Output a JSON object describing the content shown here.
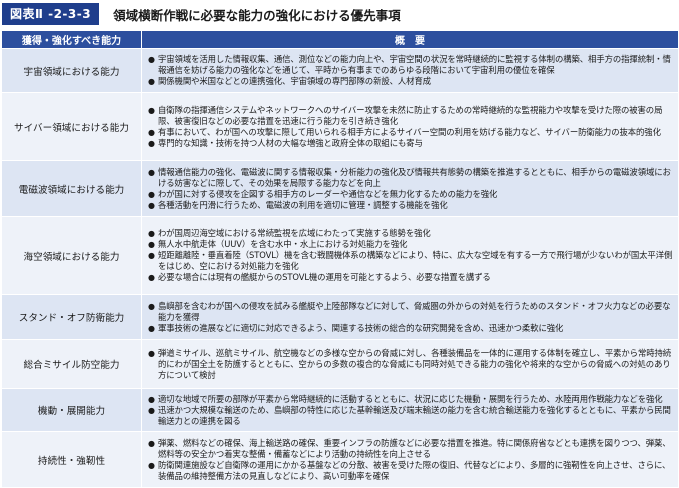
{
  "figure": {
    "label": "図表Ⅱ -2-3-3",
    "title": "領域横断作戦に必要な能力の強化における優先事項"
  },
  "table": {
    "headers": [
      "獲得・強化すべき能力",
      "概　要"
    ],
    "bullet": "●",
    "rows": [
      {
        "capability": "宇宙領域における能力",
        "items": [
          "宇宙領域を活用した情報収集、通信、測位などの能力向上や、宇宙空間の状況を常時継続的に監視する体制の構築、相手方の指揮統制・情報通信を妨げる能力の強化などを通じて、平時から有事までのあらゆる段階において宇宙利用の優位を確保",
          "関係機関や米国などとの連携強化、宇宙領域の専門部隊の新設、人材育成"
        ]
      },
      {
        "capability": "サイバー領域における能力",
        "items": [
          "自衛隊の指揮通信システムやネットワークへのサイバー攻撃を未然に防止するための常時継続的な監視能力や攻撃を受けた際の被害の局限、被害復旧などの必要な措置を迅速に行う能力を引き続き強化",
          "有事において、わが国への攻撃に際して用いられる相手方によるサイバー空間の利用を妨げる能力など、サイバー防衛能力の抜本的強化",
          "専門的な知識・技術を持つ人材の大幅な増強と政府全体の取組にも寄与"
        ]
      },
      {
        "capability": "電磁波領域における能力",
        "items": [
          "情報通信能力の強化、電磁波に関する情報収集・分析能力の強化及び情報共有態勢の構築を推進するとともに、相手からの電磁波領域における妨害などに際して、その効果を局限する能力などを向上",
          "わが国に対する侵攻を企図する相手方のレーダーや通信などを無力化するための能力を強化",
          "各種活動を円滑に行うため、電磁波の利用を適切に管理・調整する機能を強化"
        ]
      },
      {
        "capability": "海空領域における能力",
        "items": [
          "わが国周辺海空域における常続監視を広域にわたって実施する態勢を強化",
          "無人水中航走体（UUV）を含む水中・水上における対処能力を強化",
          "短距離離陸・垂直着陸（STOVL）機を含む戦闘機体系の構築などにより、特に、広大な空域を有する一方で飛行場が少ないわが国太平洋側をはじめ、空における対処能力を強化",
          "必要な場合には現有の艦艇からのSTOVL機の運用を可能とするよう、必要な措置を講ずる"
        ]
      },
      {
        "capability": "スタンド・オフ防衛能力",
        "items": [
          "島嶼部を含むわが国への侵攻を試みる艦艇や上陸部隊などに対して、脅威圏の外からの対処を行うためのスタンド・オフ火力などの必要な能力を獲得",
          "軍事技術の進展などに適切に対応できるよう、関連する技術の総合的な研究開発を含め、迅速かつ柔軟に強化"
        ]
      },
      {
        "capability": "総合ミサイル防空能力",
        "items": [
          "弾道ミサイル、巡航ミサイル、航空機などの多様な空からの脅威に対し、各種装備品を一体的に運用する体制を確立し、平素から常時持続的にわが国全土を防護するとともに、空からの多数の複合的な脅威にも同時対処できる能力の強化や将来的な空からの脅威への対処のあり方について検討"
        ]
      },
      {
        "capability": "機動・展開能力",
        "items": [
          "適切な地域で所要の部隊が平素から常時継続的に活動するとともに、状況に応じた機動・展開を行うため、水陸両用作戦能力などを強化",
          "迅速かつ大規模な輸送のため、島嶼部の特性に応じた基幹輸送及び端末輸送の能力を含む統合輸送能力を強化するとともに、平素から民間輸送力との連携を図る"
        ]
      },
      {
        "capability": "持続性・強靭性",
        "items": [
          "弾薬、燃料などの確保、海上輸送路の確保、重要インフラの防護などに必要な措置を推進。特に関係府省などとも連携を図りつつ、弾薬、燃料等の安全かつ着実な整備・備蓄などにより活動の持続性を向上させる",
          "防衛関連施設など自衛隊の運用にかかる基盤などの分散、被害を受けた際の復旧、代替などにより、多層的に強靭性を向上させ、さらに、装備品の維持整備方法の見直しなどにより、高い可動率を確保"
        ]
      }
    ]
  }
}
